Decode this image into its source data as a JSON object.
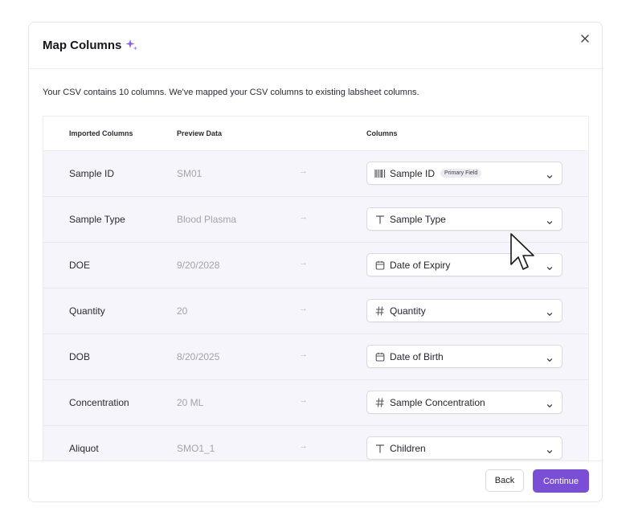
{
  "modal": {
    "title": "Map Columns",
    "intro": "Your CSV contains 10 columns. We've mapped your CSV columns to existing labsheet columns."
  },
  "table": {
    "headers": {
      "imported": "Imported Columns",
      "preview": "Preview Data",
      "columns": "Columns"
    },
    "rows": [
      {
        "imported": "Sample ID",
        "preview": "SM01",
        "arrow": "→",
        "field": "Sample ID",
        "icon": "barcode-icon",
        "badge": "Primary Field"
      },
      {
        "imported": "Sample Type",
        "preview": "Blood Plasma",
        "arrow": "→",
        "field": "Sample Type",
        "icon": "text-icon"
      },
      {
        "imported": "DOE",
        "preview": "9/20/2028",
        "arrow": "→",
        "field": "Date of Expiry",
        "icon": "calendar-icon"
      },
      {
        "imported": "Quantity",
        "preview": "20",
        "arrow": "→",
        "field": "Quantity",
        "icon": "hash-icon"
      },
      {
        "imported": "DOB",
        "preview": "8/20/2025",
        "arrow": "→",
        "field": "Date of Birth",
        "icon": "calendar-icon"
      },
      {
        "imported": "Concentration",
        "preview": "20 ML",
        "arrow": "→",
        "field": "Sample Concentration",
        "icon": "hash-icon"
      },
      {
        "imported": "Aliquot",
        "preview": "SMO1_1",
        "arrow": "→",
        "field": "Children",
        "icon": "text-icon"
      }
    ]
  },
  "footer": {
    "back_label": "Back",
    "continue_label": "Continue"
  },
  "colors": {
    "accent": "#7a4fd6",
    "row_bg": "#f6f5fb",
    "sparkle": "#8b5cf6"
  }
}
